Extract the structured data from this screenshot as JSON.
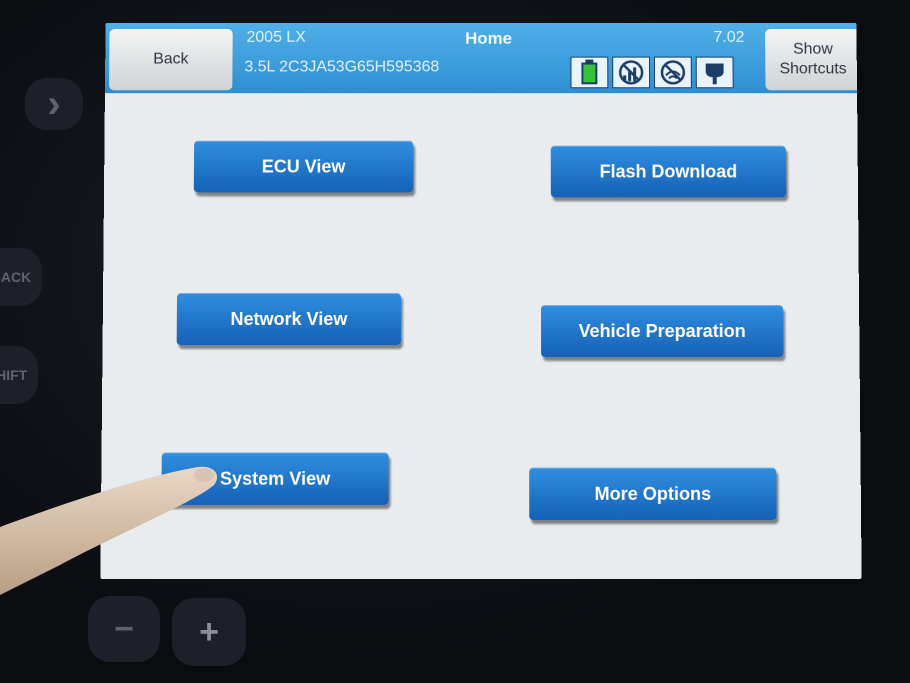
{
  "header": {
    "back_label": "Back",
    "vehicle_line1": "2005 LX",
    "vehicle_line2": "3.5L  2C3JA53G65H595368",
    "title": "Home",
    "version": "7.02",
    "shortcuts_line1": "Show",
    "shortcuts_line2": "Shortcuts",
    "status_icons": [
      "battery-icon",
      "no-signal-icon",
      "no-wireless-icon",
      "vehicle-connector-icon"
    ]
  },
  "menu": {
    "ecu_view": "ECU View",
    "flash_download": "Flash Download",
    "network_view": "Network View",
    "vehicle_preparation": "Vehicle Preparation",
    "system_view": "System View",
    "more_options": "More Options"
  },
  "hardware": {
    "back_key": "BACK",
    "shift_key": "SHIFT",
    "minus_key": "−",
    "plus_key": "+",
    "next_key": "›"
  },
  "colors": {
    "header_blue": "#2e8fd0",
    "button_blue": "#1a6fc6",
    "screen_bg": "#e9ecef"
  }
}
